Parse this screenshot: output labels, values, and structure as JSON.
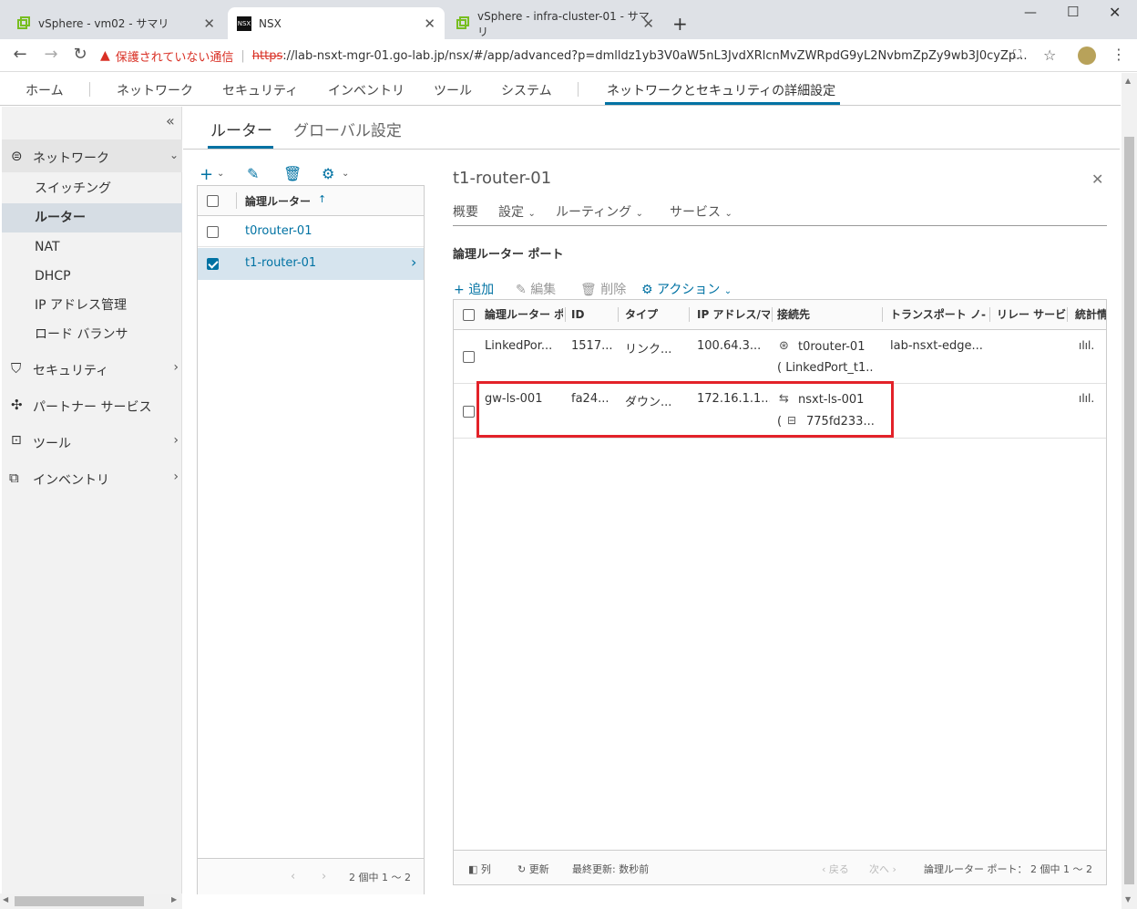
{
  "browser": {
    "tabs": [
      {
        "title": "vSphere - vm02 - サマリ"
      },
      {
        "title": "NSX"
      },
      {
        "title": "vSphere - infra-cluster-01 - サマリ"
      }
    ],
    "new_tab": "+",
    "security_warning": "保護されていない通信",
    "url_scheme": "https",
    "url_rest": "://lab-nsxt-mgr-01.go-lab.jp/nsx/#/app/advanced?p=dmlldz1yb3V0aW5nL3JvdXRlcnMvZWRpdG9yL2NvbmZpZy9wb3J0cyZp..."
  },
  "topnav": {
    "items": [
      "ホーム",
      "ネットワーク",
      "セキュリティ",
      "インベントリ",
      "ツール",
      "システム"
    ],
    "active": "ネットワークとセキュリティの詳細設定"
  },
  "sidebar": {
    "collapse": "«",
    "network": "ネットワーク",
    "network_items": [
      "スイッチング",
      "ルーター",
      "NAT",
      "DHCP",
      "IP アドレス管理",
      "ロード バランサ"
    ],
    "security": "セキュリティ",
    "partner": "パートナー サービス",
    "tools": "ツール",
    "inventory": "インベントリ"
  },
  "page_tabs": {
    "routers": "ルーター",
    "global": "グローバル設定"
  },
  "router_list": {
    "header": "論理ルーター",
    "rows": [
      "t0router-01",
      "t1-router-01"
    ],
    "pagination": "2 個中 1 ～ 2"
  },
  "detail": {
    "title": "t1-router-01",
    "tabs": [
      "概要",
      "設定",
      "ルーティング",
      "サービス"
    ],
    "section": "論理ルーター ポート",
    "toolbar": {
      "add": "追加",
      "edit": "編集",
      "delete": "削除",
      "actions": "アクション"
    },
    "columns": [
      "論理ルーター ポ",
      "ID",
      "タイプ",
      "IP アドレス/マ",
      "接続先",
      "トランスポート ノ-",
      "リレー サービ",
      "統計情"
    ],
    "ports": [
      {
        "name": "LinkedPor...",
        "id": "1517....",
        "type": "リンク...",
        "ip": "100.64.3...",
        "conn": "t0router-01",
        "conn_sub": "( LinkedPort_t1...",
        "transport": "lab-nsxt-edge..."
      },
      {
        "name": "gw-ls-001",
        "id": "fa24...",
        "type": "ダウン...",
        "ip": "172.16.1.1...",
        "conn": "nsxt-ls-001",
        "conn_sub_prefix": "(",
        "conn_sub": "775fd233...",
        "transport": ""
      }
    ],
    "footer": {
      "columns": "列",
      "refresh": "更新",
      "last_updated": "最終更新: 数秒前",
      "prev": "戻る",
      "next": "次へ",
      "count": "論理ルーター ポート： 2 個中 1 ～ 2"
    }
  },
  "colors": {
    "accent": "#0072a3",
    "highlight": "#e32229"
  }
}
